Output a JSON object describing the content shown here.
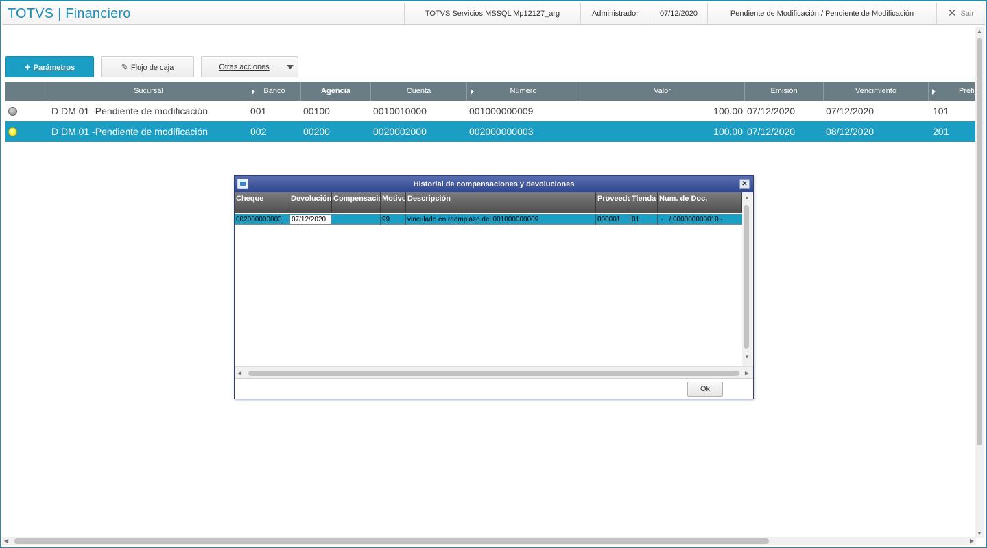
{
  "header": {
    "app_title": "TOTVS | Financiero",
    "environment": "TOTVS Servicios MSSQL Mp12127_arg",
    "user": "Administrador",
    "date": "07/12/2020",
    "context": "Pendiente de Modificación / Pendiente de Modificación",
    "exit_label": "Sair"
  },
  "toolbar": {
    "params_label": "Parámetros",
    "cashflow_label": "Flujo de caja",
    "other_actions_label": "Otras acciones"
  },
  "grid": {
    "columns": [
      "Sucursal",
      "Banco",
      "Agencia",
      "Cuenta",
      "Número",
      "Valor",
      "Emisión",
      "Vencimiento",
      "Prefijo"
    ],
    "rows": [
      {
        "status": "gray",
        "sucursal": "D DM 01 -Pendiente de modificación",
        "banco": "001",
        "agencia": "00100",
        "cuenta": "0010010000",
        "numero": "001000000009",
        "valor": "100.00",
        "emision": "07/12/2020",
        "vencimiento": "07/12/2020",
        "prefijo": "101"
      },
      {
        "status": "yellow",
        "sucursal": "D DM 01 -Pendiente de modificación",
        "banco": "002",
        "agencia": "00200",
        "cuenta": "0020002000",
        "numero": "002000000003",
        "valor": "100.00",
        "emision": "07/12/2020",
        "vencimiento": "08/12/2020",
        "prefijo": "201"
      }
    ]
  },
  "dialog": {
    "title": "Historial de compensaciones y devoluciones",
    "columns": [
      "Cheque",
      "Devolución",
      "Compensación",
      "Motivo",
      "Descripción",
      "Proveedor",
      "Tienda",
      "Num. de Doc."
    ],
    "rows": [
      {
        "cheque": "002000000003",
        "devolucion": "07/12/2020",
        "compensacion": "",
        "motivo": "99",
        "descripcion": "vinculado en reemplazo del 001000000009",
        "proveedor": "000001",
        "tienda": "01",
        "num_doc": " -   / 000000000010 -"
      }
    ],
    "ok_label": "Ok"
  }
}
